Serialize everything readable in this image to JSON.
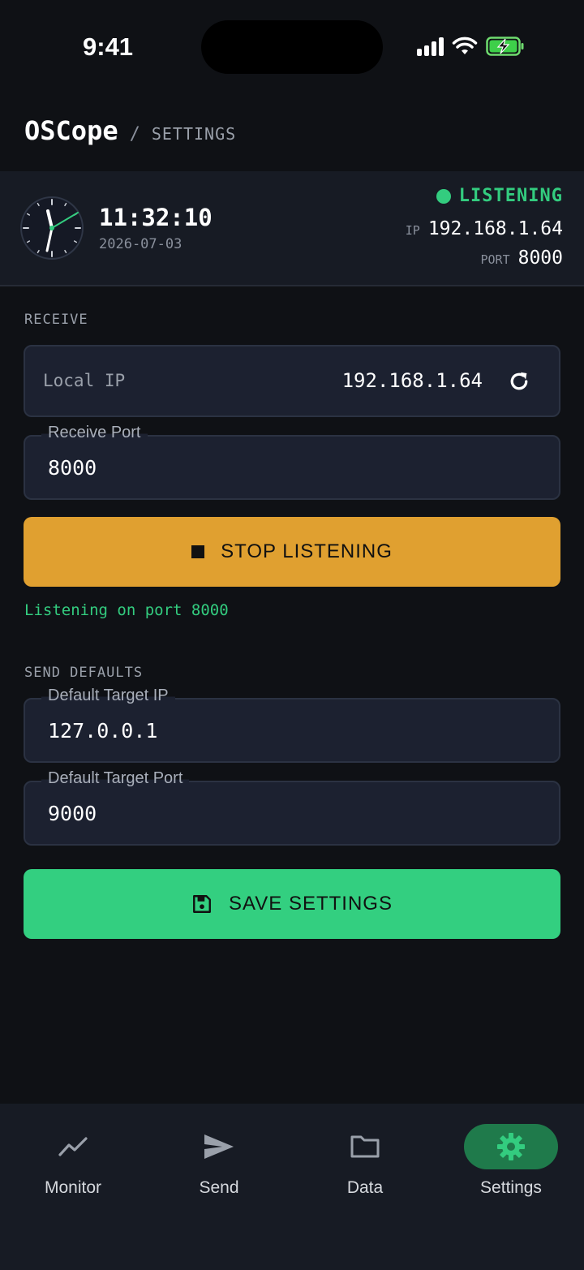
{
  "status_bar": {
    "time": "9:41"
  },
  "header": {
    "app_title": "OSCope",
    "separator": "/",
    "breadcrumb": "SETTINGS"
  },
  "clock": {
    "time": "11:32:10",
    "date": "2026-07-03",
    "connection_status": "LISTENING",
    "ip_key": "IP",
    "ip_value": "192.168.1.64",
    "port_key": "PORT",
    "port_value": "8000"
  },
  "receive": {
    "section_label": "RECEIVE",
    "local_ip_label": "Local IP",
    "local_ip_value": "192.168.1.64",
    "receive_port_label": "Receive Port",
    "receive_port_value": "8000",
    "stop_button_label": "STOP LISTENING",
    "status_message": "Listening on port 8000"
  },
  "send_defaults": {
    "section_label": "SEND DEFAULTS",
    "target_ip_label": "Default Target IP",
    "target_ip_value": "127.0.0.1",
    "target_port_label": "Default Target Port",
    "target_port_value": "9000",
    "save_button_label": "SAVE SETTINGS"
  },
  "bottom_nav": {
    "items": [
      {
        "label": "Monitor",
        "icon": "chart-line-icon"
      },
      {
        "label": "Send",
        "icon": "send-icon"
      },
      {
        "label": "Data",
        "icon": "folder-icon"
      },
      {
        "label": "Settings",
        "icon": "gear-icon",
        "active": true
      }
    ]
  },
  "colors": {
    "accent_green": "#33cc7f",
    "stop_orange": "#e0a030",
    "background": "#0f1115"
  }
}
